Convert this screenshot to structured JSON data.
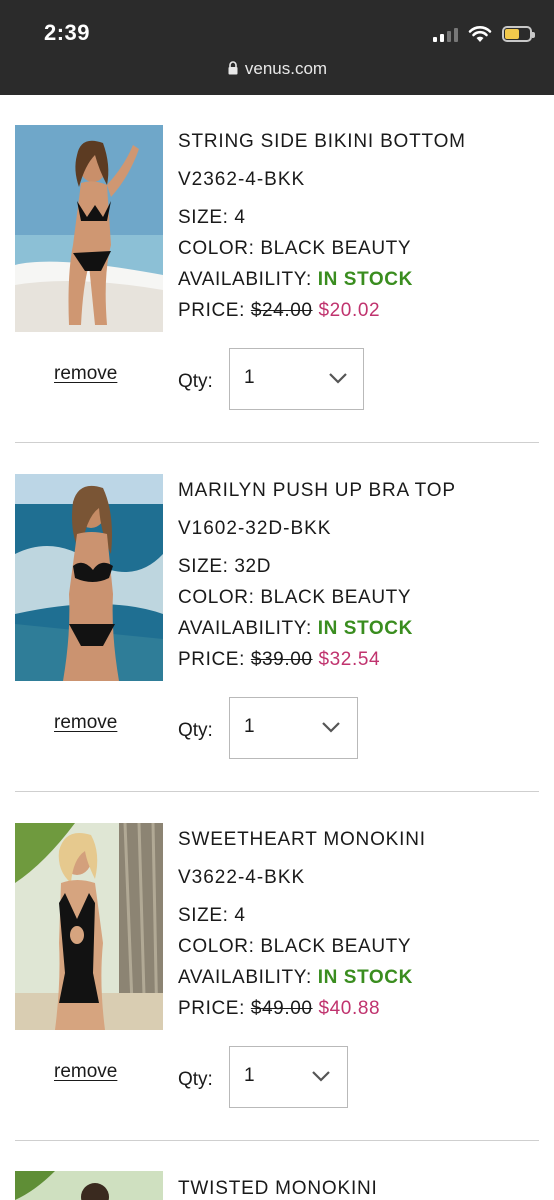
{
  "status_bar": {
    "time": "2:39"
  },
  "browser": {
    "url": "venus.com"
  },
  "cart_items": [
    {
      "name": "STRING SIDE BIKINI BOTTOM",
      "sku": "V2362-4-BKK",
      "size": "SIZE: 4",
      "color": "COLOR: BLACK BEAUTY",
      "availability_label": "AVAILABILITY:",
      "availability": "IN STOCK",
      "price_label": "PRICE:",
      "original_price": "$24.00",
      "sale_price": "$20.02",
      "remove_label": "remove",
      "qty_label": "Qty:",
      "qty": "1"
    },
    {
      "name": "MARILYN PUSH UP BRA TOP",
      "sku": "V1602-32D-BKK",
      "size": "SIZE: 32D",
      "color": "COLOR: BLACK BEAUTY",
      "availability_label": "AVAILABILITY:",
      "availability": "IN STOCK",
      "price_label": "PRICE:",
      "original_price": "$39.00",
      "sale_price": "$32.54",
      "remove_label": "remove",
      "qty_label": "Qty:",
      "qty": "1"
    },
    {
      "name": "SWEETHEART MONOKINI",
      "sku": "V3622-4-BKK",
      "size": "SIZE: 4",
      "color": "COLOR: BLACK BEAUTY",
      "availability_label": "AVAILABILITY:",
      "availability": "IN STOCK",
      "price_label": "PRICE:",
      "original_price": "$49.00",
      "sale_price": "$40.88",
      "remove_label": "remove",
      "qty_label": "Qty:",
      "qty": "1"
    },
    {
      "name": "TWISTED MONOKINI"
    }
  ],
  "colors": {
    "in_stock": "#3a8d1f",
    "sale_price": "#c0336e",
    "top_bar": "#2b2b2b"
  }
}
